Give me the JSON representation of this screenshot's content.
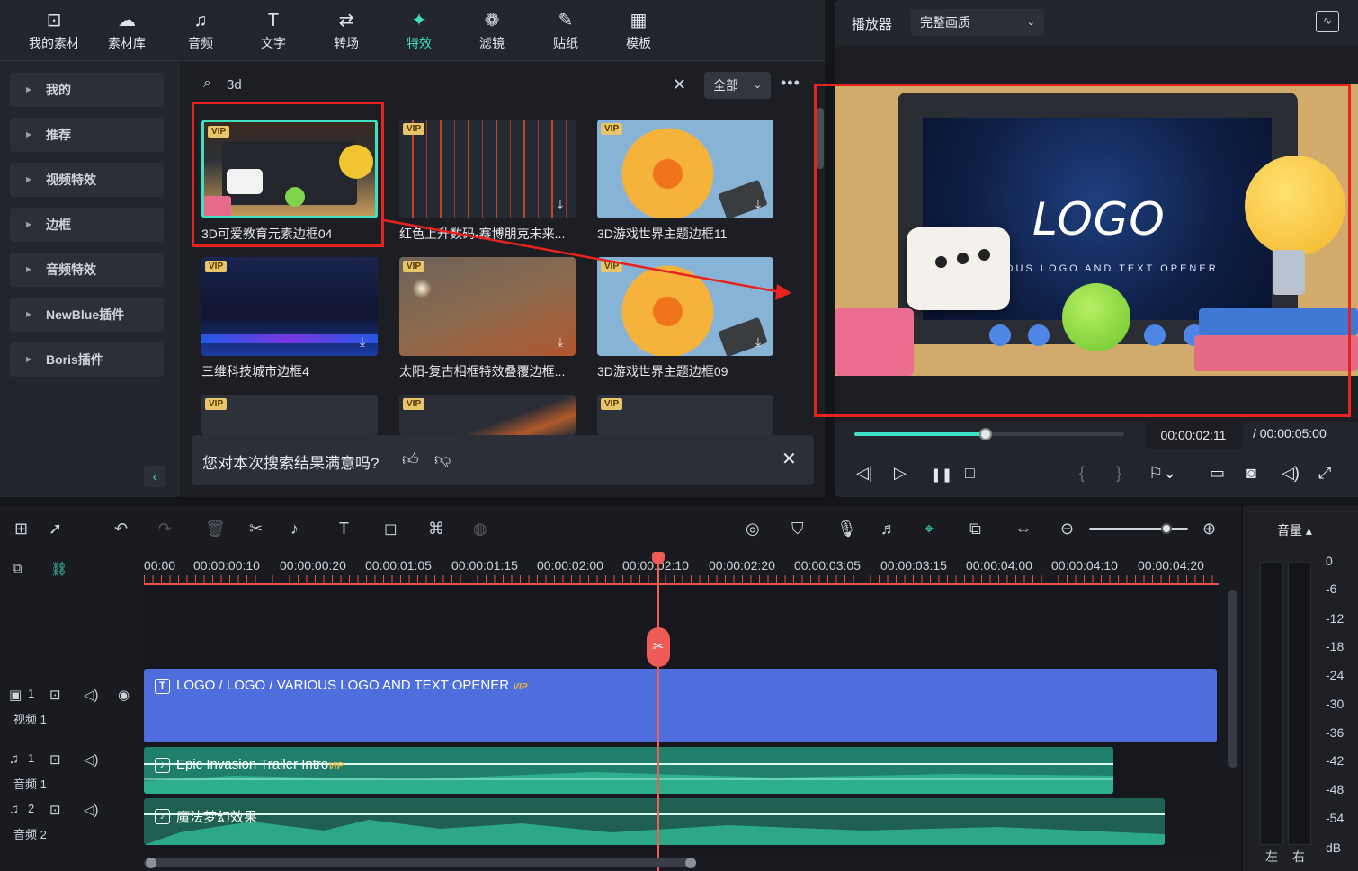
{
  "nav": {
    "items": [
      {
        "label": "我的素材",
        "icon": "my-media-icon",
        "glyph": "⊡"
      },
      {
        "label": "素材库",
        "icon": "stock-library-icon",
        "glyph": "☁"
      },
      {
        "label": "音频",
        "icon": "audio-note-icon",
        "glyph": "♫"
      },
      {
        "label": "文字",
        "icon": "text-t-icon",
        "glyph": "T"
      },
      {
        "label": "转场",
        "icon": "transition-icon",
        "glyph": "⇄"
      },
      {
        "label": "特效",
        "icon": "effects-star-icon",
        "glyph": "✦"
      },
      {
        "label": "滤镜",
        "icon": "filter-icon",
        "glyph": "❁"
      },
      {
        "label": "贴纸",
        "icon": "sticker-icon",
        "glyph": "✎"
      },
      {
        "label": "模板",
        "icon": "template-icon",
        "glyph": "▦"
      }
    ],
    "active": "特效"
  },
  "sidebar": {
    "items": [
      {
        "label": "我的"
      },
      {
        "label": "推荐"
      },
      {
        "label": "视频特效"
      },
      {
        "label": "边框"
      },
      {
        "label": "音频特效"
      },
      {
        "label": "NewBlue插件"
      },
      {
        "label": "Boris插件"
      }
    ],
    "collapse_glyph": "‹"
  },
  "search": {
    "value": "3d",
    "clear": "✕",
    "glyph": "⌕"
  },
  "filter": {
    "value": "全部",
    "chev": "⌄"
  },
  "more": "•••",
  "cards": [
    {
      "label": "3D可爱教育元素边框04",
      "badge": "VIP",
      "download": false
    },
    {
      "label": "红色上升数码-赛博朋克未来...",
      "badge": "VIP",
      "download": true
    },
    {
      "label": "3D游戏世界主题边框11",
      "badge": "VIP",
      "download": true
    },
    {
      "label": "三维科技城市边框4",
      "badge": "VIP",
      "download": true
    },
    {
      "label": "太阳-复古相框特效叠覆边框...",
      "badge": "VIP",
      "download": true
    },
    {
      "label": "3D游戏世界主题边框09",
      "badge": "VIP",
      "download": true
    },
    {
      "label": "",
      "badge": "VIP",
      "download": false
    },
    {
      "label": "",
      "badge": "VIP",
      "download": false
    },
    {
      "label": "",
      "badge": "VIP",
      "download": false
    }
  ],
  "feedback": {
    "question": "您对本次搜索结果满意吗?",
    "like": "👍︎",
    "dislike": "👎︎",
    "close": "✕"
  },
  "player": {
    "title": "播放器",
    "quality": "完整画质",
    "preview_logo": "LOGO",
    "preview_sub": "OUS LOGO AND TEXT OPENER",
    "current_time": "00:00:02:11",
    "total_time": "/  00:00:05:00",
    "progress": 0.49,
    "controls": {
      "prev": "◁|",
      "play": "▷",
      "pause": "❚❚",
      "stop": "□",
      "mark_in": "{",
      "mark_out": "}"
    }
  },
  "timeline": {
    "ticks": [
      "00:00",
      "00:00:00:10",
      "00:00:00:20",
      "00:00:01:05",
      "00:00:01:15",
      "00:00:02:00",
      "00:00:02:10",
      "00:00:02:20",
      "00:00:03:05",
      "00:00:03:15",
      "00:00:04:00",
      "00:00:04:10",
      "00:00:04:20"
    ],
    "tracks": {
      "video1": {
        "num": "1",
        "name": "视频 1"
      },
      "audio1": {
        "num": "1",
        "name": "音频 1"
      },
      "audio2": {
        "num": "2",
        "name": "音频 2"
      }
    },
    "clips": {
      "video": {
        "label": "LOGO / LOGO / VARIOUS LOGO AND TEXT OPENER",
        "vip": "VIP",
        "icon": "T"
      },
      "audio1": {
        "label": "Epic Invasion Trailer Intro",
        "vip": "VIP",
        "icon": "♪"
      },
      "audio2": {
        "label": "魔法梦幻效果",
        "icon": "♪"
      }
    },
    "cut_glyph": "✂"
  },
  "meter": {
    "title": "音量 ▴",
    "db": [
      "0",
      "-6",
      "-12",
      "-18",
      "-24",
      "-30",
      "-36",
      "-42",
      "-48",
      "-54",
      "dB"
    ],
    "left": "左",
    "right": "右"
  },
  "colors": {
    "accent": "#3fe0c2",
    "highlight": "#e8231f",
    "video_clip": "#4f6ede",
    "audio_clip": "#1f7f6b",
    "playhead": "#f05a57"
  }
}
